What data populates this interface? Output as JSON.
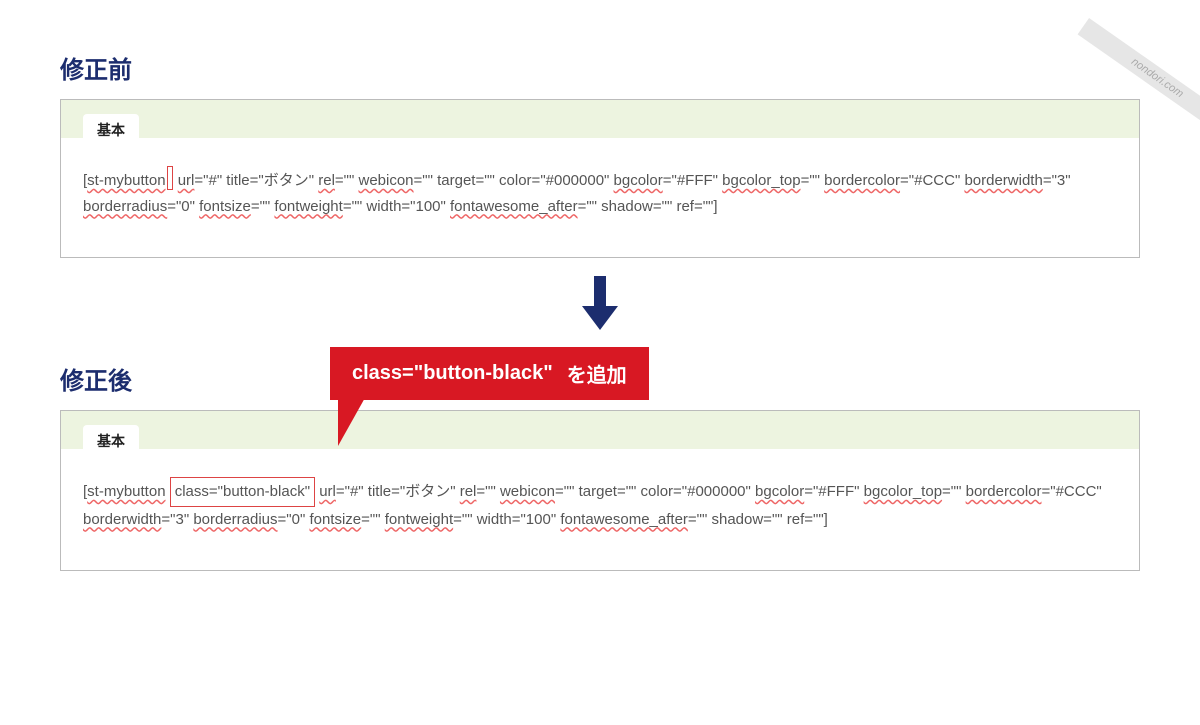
{
  "watermark": "nondori.com",
  "before": {
    "title": "修正前",
    "box_label": "基本",
    "code_parts": {
      "p1": "[",
      "p2": "st-mybutton",
      "p3": " ",
      "p4": "url",
      "p5": "=\"#\" title=\"ボタン\" ",
      "p6": "rel",
      "p7": "=\"\" ",
      "p8": "webicon",
      "p9": "=\"\" target=\"\" color=\"#000000\" ",
      "p10": "bgcolor",
      "p11": "=\"#FFF\" ",
      "p12": "bgcolor_top",
      "p13": "=\"\" ",
      "p14": "bordercolor",
      "p15": "=\"#CCC\" ",
      "p16": "borderwidth",
      "p17": "=\"3\" ",
      "p18": "borderradius",
      "p19": "=\"0\" ",
      "p20": "fontsize",
      "p21": "=\"\" ",
      "p22": "fontweight",
      "p23": "=\"\" width=\"100\" ",
      "p24": "fontawesome_after",
      "p25": "=\"\" shadow=\"\" ref=\"\"]"
    }
  },
  "callout": {
    "code": "class=\"button-black\"",
    "text": "を追加"
  },
  "after": {
    "title": "修正後",
    "box_label": "基本",
    "code_parts": {
      "p1": "[",
      "p2": "st-mybutton",
      "p3": " ",
      "hl": "class=\"button-black\"",
      "p4": " ",
      "p5": "url",
      "p6": "=\"#\" title=\"ボタン\" ",
      "p7": "rel",
      "p8": "=\"\" ",
      "p9": "webicon",
      "p10": "=\"\" target=\"\" color=\"#000000\" ",
      "p11": "bgcolor",
      "p12": "=\"#FFF\" ",
      "p13": "bgcolor_top",
      "p14": "=\"\" ",
      "p15": "bordercolor",
      "p16": "=\"#CCC\" ",
      "p17": "borderwidth",
      "p18": "=\"3\" ",
      "p19": "borderradius",
      "p20": "=\"0\" ",
      "p21": "fontsize",
      "p22": "=\"\" ",
      "p23": "fontweight",
      "p24": "=\"\" width=\"100\" ",
      "p25": "fontawesome_after",
      "p26": "=\"\" shadow=\"\" ref=\"\"]"
    }
  }
}
